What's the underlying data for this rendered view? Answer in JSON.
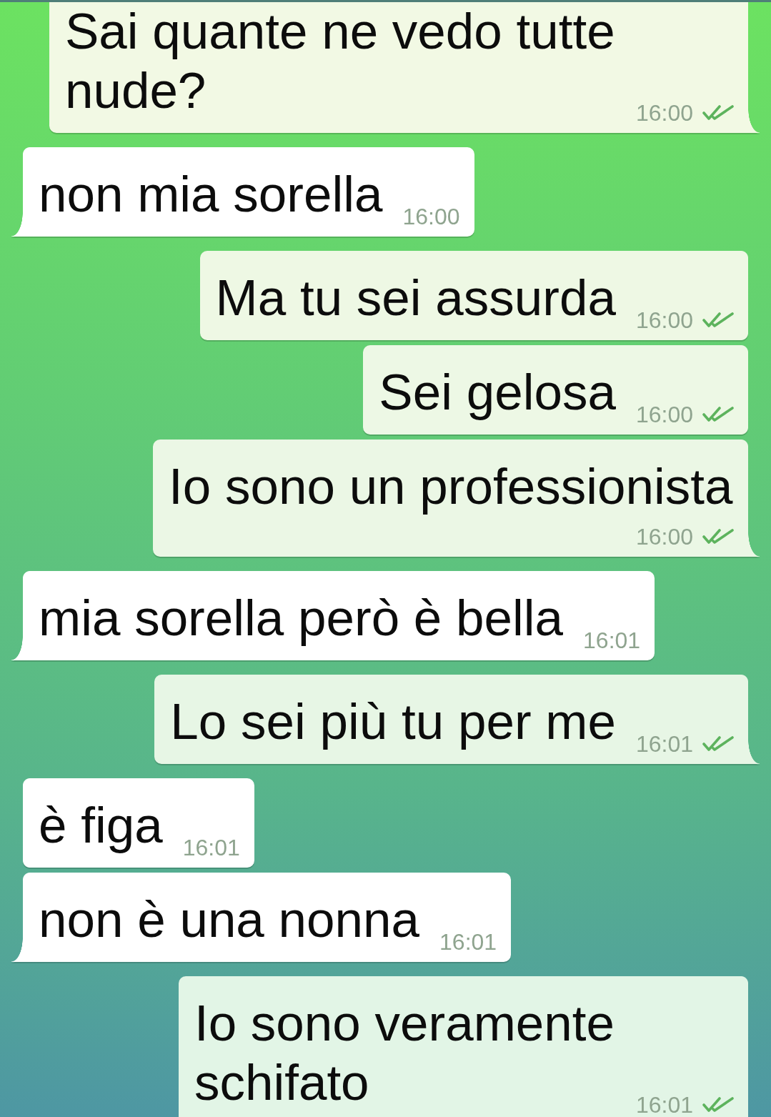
{
  "messages": [
    {
      "text": "Sai quante ne vedo tutte nude?",
      "time": "16:00",
      "outgoing": true,
      "delivered": true
    },
    {
      "text": "non mia sorella",
      "time": "16:00",
      "outgoing": false
    },
    {
      "text": "Ma tu sei assurda",
      "time": "16:00",
      "outgoing": true,
      "delivered": true
    },
    {
      "text": "Sei gelosa",
      "time": "16:00",
      "outgoing": true,
      "delivered": true
    },
    {
      "text": "Io sono un professionista",
      "time": "16:00",
      "outgoing": true,
      "delivered": true
    },
    {
      "text": "mia sorella però è bella",
      "time": "16:01",
      "outgoing": false
    },
    {
      "text": "Lo sei più tu per me",
      "time": "16:01",
      "outgoing": true,
      "delivered": true
    },
    {
      "text": "è figa",
      "time": "16:01",
      "outgoing": false
    },
    {
      "text": "non è una nonna",
      "time": "16:01",
      "outgoing": false
    },
    {
      "text": "Io sono veramente schifato",
      "time": "16:01",
      "outgoing": true,
      "delivered": true
    }
  ]
}
